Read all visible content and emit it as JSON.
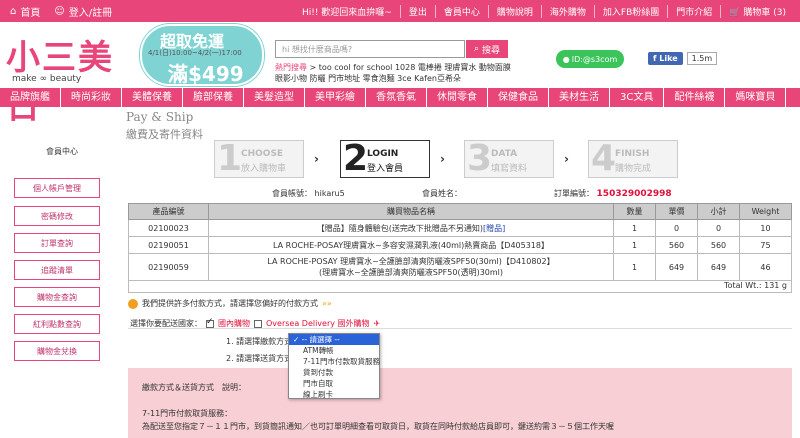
{
  "topbar": {
    "home": "首頁",
    "login": "登入/註冊",
    "right_items": [
      "Hi!! 歡迎回來血拚囉~",
      "登出",
      "會員中心",
      "購物說明",
      "海外購物",
      "加入FB粉絲團",
      "門市介紹",
      "購物車 (3)"
    ]
  },
  "logo": {
    "cn": "小三美日",
    "en": "make ∞ beauty"
  },
  "promo": {
    "title": "超取免運",
    "dates": "4/1(日)10:00~4/2(一)17:00",
    "threshold": "滿$499"
  },
  "search": {
    "placeholder": "hi 想找什麼商品嗎?",
    "button": "搜尋",
    "hot_label": "熱門搜尋",
    "hot_line1": "> too cool for school  1028  電棒捲  理膚寶水  動物面膜",
    "hot_line2": "眼影小物  防曬  門市地址  零食泡麵  3ce  Kafen亞希朵"
  },
  "line": "ID:@s3com",
  "fb": {
    "like": "Like",
    "count": "1.5m"
  },
  "nav": [
    "品牌旗艦",
    "時尚彩妝",
    "美體保養",
    "臉部保養",
    "美髮造型",
    "美甲彩繪",
    "香氛香氣",
    "休閒零食",
    "保健食品",
    "美材生活",
    "3C文具",
    "配件絲襪",
    "媽咪寶貝"
  ],
  "page": {
    "title": "Pay & Ship",
    "subtitle": "繳費及寄件資料"
  },
  "side": {
    "title": "會員中心",
    "items": [
      "個人帳戶管理",
      "密碼修改",
      "訂單查詢",
      "追蹤清單",
      "購物金查詢",
      "紅利點數查詢",
      "購物金兌換"
    ]
  },
  "steps": [
    {
      "num": "1",
      "en": "CHOOSE",
      "zh": "放入購物車"
    },
    {
      "num": "2",
      "en": "LOGIN",
      "zh": "登入會員"
    },
    {
      "num": "3",
      "en": "DATA",
      "zh": "填寫資料"
    },
    {
      "num": "4",
      "en": "FINISH",
      "zh": "購物完成"
    }
  ],
  "account": {
    "member_label": "會員帳號：",
    "member_value": "hikaru5",
    "name_label": "會員姓名：",
    "order_label": "訂單編號：",
    "order_value": "150329002998"
  },
  "table": {
    "headers": [
      "產品編號",
      "購買物品名稱",
      "數量",
      "單價",
      "小計",
      "Weight"
    ],
    "rows": [
      {
        "id": "02100023",
        "name": "【贈品】隨身體驗包(送完改下批贈品不另通知)",
        "tag": "[贈品]",
        "qty": "1",
        "price": "0",
        "subtotal": "0",
        "weight": "10"
      },
      {
        "id": "02190051",
        "name": "LA ROCHE-POSAY理膚寶水~多容安濕潤乳液(40ml)熱賣商品【D405318】",
        "tag": "",
        "qty": "1",
        "price": "560",
        "subtotal": "560",
        "weight": "75"
      },
      {
        "id": "02190059",
        "name": "LA ROCHE-POSAY 理膚寶水~全護臉部清爽防曬液SPF50(30ml)【D410802】",
        "name2": "(理膚寶水~全護臉部清爽防曬液SPF50(透明)30ml)",
        "tag": "",
        "qty": "1",
        "price": "649",
        "subtotal": "649",
        "weight": "46"
      }
    ],
    "total": "Total Wt.: 131 g"
  },
  "pay_prompt": "我們提供許多付款方式，請選擇您偏好的付款方式",
  "ship_select": {
    "label": "選擇你要配送國家：",
    "domestic": "國內購物",
    "overseas": "Oversea Delivery 國外購物"
  },
  "form": {
    "q1": "1. 請選擇繳款方式",
    "q2": "2. 請選擇送貨方式",
    "options": [
      "-- 請選擇 --",
      "ATM轉帳",
      "7-11門市付款取貨服務",
      "貨到付款",
      "門市自取",
      "線上刷卡"
    ]
  },
  "info": {
    "l1": "繳款方式＆送貨方式　說明：",
    "l2": "7-11門市付款取貨服務：",
    "l3": "為配送至您指定７－１１門市，到貨簡訊通知／也可訂單明細查看可取貨日，取貨在同時付款給店員即可，鍵送約需３－５個工作天喔"
  }
}
